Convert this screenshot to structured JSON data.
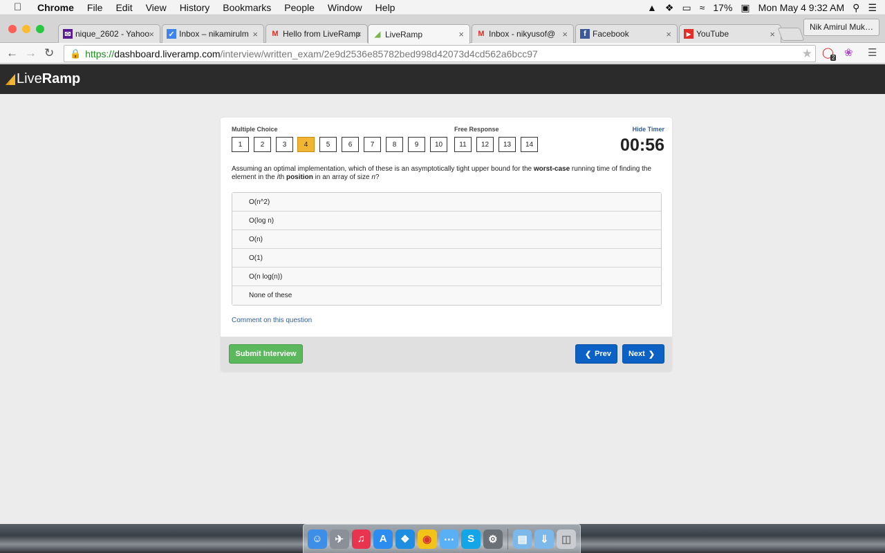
{
  "menubar": {
    "app_name": "Chrome",
    "menus": [
      "File",
      "Edit",
      "View",
      "History",
      "Bookmarks",
      "People",
      "Window",
      "Help"
    ],
    "battery": "17%",
    "clock": "Mon May 4  9:32 AM"
  },
  "browser": {
    "tabs": [
      {
        "title": "nique_2602 - Yahoo",
        "icon": "yahoo-mail-icon"
      },
      {
        "title": "Inbox – nikamirulm",
        "icon": "inbox-icon"
      },
      {
        "title": "Hello from LiveRamp",
        "icon": "gmail-icon"
      },
      {
        "title": "LiveRamp",
        "icon": "liveramp-icon"
      },
      {
        "title": "Inbox - nikyusof@",
        "icon": "gmail-icon"
      },
      {
        "title": "Facebook",
        "icon": "facebook-icon"
      },
      {
        "title": "YouTube",
        "icon": "youtube-icon"
      }
    ],
    "active_tab": 3,
    "profile_name": "Nik Amirul Muk…",
    "url_scheme": "https://",
    "url_host": "dashboard.liveramp.com",
    "url_path": "/interview/written_exam/2e9d2536e85782bed998d42073d4cd562a6bcc97",
    "extension_badge": "2"
  },
  "site": {
    "logo_light": "Live",
    "logo_bold": "Ramp",
    "brand_color": "#f1b534"
  },
  "exam": {
    "mc_label": "Multiple Choice",
    "fr_label": "Free Response",
    "mc_questions": [
      "1",
      "2",
      "3",
      "4",
      "5",
      "6",
      "7",
      "8",
      "9",
      "10"
    ],
    "fr_questions": [
      "11",
      "12",
      "13",
      "14"
    ],
    "current_question": "4",
    "hide_timer_label": "Hide Timer",
    "timer": "00:56",
    "question": {
      "part1": "Assuming an optimal implementation, which of these is an asymptotically tight upper bound for the ",
      "bold1": "worst-case",
      "part2": " running time of finding the element in the ",
      "italic1": "i",
      "part3": "th ",
      "bold2": "position",
      "part4": " in an array of size ",
      "italic2": "n",
      "part5": "?"
    },
    "answers": [
      "O(n^2)",
      "O(log n)",
      "O(n)",
      "O(1)",
      "O(n log(n))",
      "None of these"
    ],
    "comment_link": "Comment on this question",
    "submit_label": "Submit Interview",
    "prev_label": "Prev",
    "next_label": "Next"
  },
  "dock": {
    "apps": [
      "finder-icon",
      "launchpad-icon",
      "itunes-icon",
      "app-store-icon",
      "safari-icon",
      "chrome-icon",
      "messages-icon",
      "skype-icon",
      "system-preferences-icon"
    ],
    "folders": [
      "documents-folder-icon",
      "downloads-folder-icon",
      "trash-icon"
    ]
  }
}
